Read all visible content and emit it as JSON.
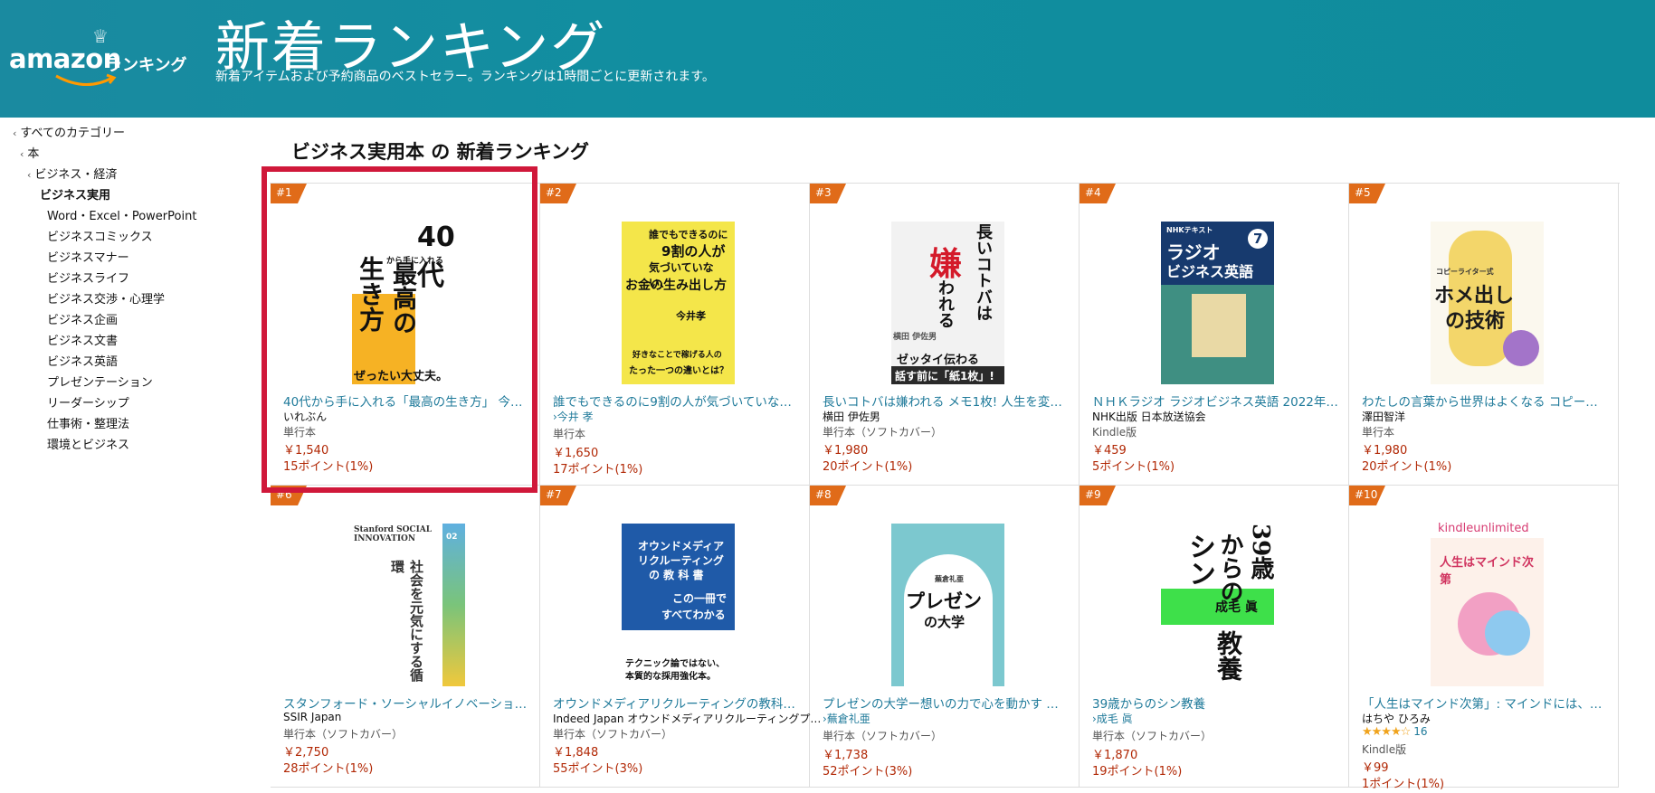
{
  "header": {
    "logo_word": "amazon",
    "logo_sub": "ランキング",
    "title": "新着ランキング",
    "subtitle": "新着アイテムおよび予約商品のベストセラー。ランキングは1時間ごとに更新されます。"
  },
  "sidebar": {
    "items": [
      {
        "label": "すべてのカテゴリー"
      },
      {
        "label": "本"
      },
      {
        "label": "ビジネス・経済"
      },
      {
        "label": "ビジネス実用"
      },
      {
        "label": "Word・Excel・PowerPoint"
      },
      {
        "label": "ビジネスコミックス"
      },
      {
        "label": "ビジネスマナー"
      },
      {
        "label": "ビジネスライフ"
      },
      {
        "label": "ビジネス交渉・心理学"
      },
      {
        "label": "ビジネス企画"
      },
      {
        "label": "ビジネス文書"
      },
      {
        "label": "ビジネス英語"
      },
      {
        "label": "プレゼンテーション"
      },
      {
        "label": "リーダーシップ"
      },
      {
        "label": "仕事術・整理法"
      },
      {
        "label": "環境とビジネス"
      }
    ]
  },
  "main": {
    "title": "ビジネス実用本 の 新着ランキング",
    "items": [
      {
        "rank": "#1",
        "title": "40代から手に入れる「最高の生き方」 今す…",
        "author": "いれぶん",
        "format": "単行本",
        "price": "￥1,540",
        "points": "15ポイント(1%)"
      },
      {
        "rank": "#2",
        "title": "誰でもできるのに9割の人が気づいていない…",
        "author": "›今井 孝",
        "format": "単行本",
        "price": "￥1,650",
        "points": "17ポイント(1%)"
      },
      {
        "rank": "#3",
        "title": "長いコトバは嫌われる メモ1枚! 人生を変え…",
        "author": "横田 伊佐男",
        "format": "単行本（ソフトカバー）",
        "price": "￥1,980",
        "points": "20ポイント(1%)"
      },
      {
        "rank": "#4",
        "title": "ＮＨＫラジオ ラジオビジネス英語 2022年 7…",
        "author": "NHK出版 日本放送協会",
        "format": "Kindle版",
        "price": "￥459",
        "points": "5ポイント(1%)"
      },
      {
        "rank": "#5",
        "title": "わたしの言葉から世界はよくなる コピーライ…",
        "author": "澤田智洋",
        "format": "単行本",
        "price": "￥1,980",
        "points": "20ポイント(1%)"
      },
      {
        "rank": "#6",
        "title": "スタンフォード・ソーシャルイノベーション…",
        "author": "SSIR Japan",
        "format": "単行本（ソフトカバー）",
        "price": "￥2,750",
        "points": "28ポイント(1%)"
      },
      {
        "rank": "#7",
        "title": "オウンドメディアリクルーティングの教科書…",
        "author": "Indeed Japan オウンドメディアリクルーティングプ…",
        "format": "単行本（ソフトカバー）",
        "price": "￥1,848",
        "points": "55ポイント(3%)"
      },
      {
        "rank": "#8",
        "title": "プレゼンの大学ー想いの力で心を動かす …",
        "author": "›蕪倉礼亜",
        "format": "単行本（ソフトカバー）",
        "price": "￥1,738",
        "points": "52ポイント(3%)"
      },
      {
        "rank": "#9",
        "title": "39歳からのシン教養",
        "author": "›成毛 眞",
        "format": "単行本（ソフトカバー）",
        "price": "￥1,870",
        "points": "19ポイント(1%)"
      },
      {
        "rank": "#10",
        "title": "「人生はマインド次第」: マインドには、か…",
        "author": "はちや ひろみ",
        "rating": 3.5,
        "reviews": "16",
        "format": "Kindle版",
        "price": "￥99",
        "points": "1ポイント(1%)"
      }
    ]
  },
  "covers": {
    "c1": {
      "a": "40代",
      "b": "最高の",
      "c": "生き方",
      "d": "から手に入れる",
      "e": "ぜったい大丈夫。"
    },
    "c2": {
      "a": "誰でもできるのに",
      "b": "9割の人が",
      "c": "気づいていない、",
      "d": "お金の生み出し方",
      "e": "今井孝",
      "f": "好きなことで稼げる人の",
      "g": "たった一つの違いとは？"
    },
    "c3": {
      "a": "長いコトバは",
      "b": "嫌",
      "c": "われる",
      "d": "ゼッタイ伝わる",
      "e": "話す前に「紙1枚」!",
      "f": "横田 伊佐男"
    },
    "c4": {
      "a": "ラジオ",
      "b": "ビジネス英語",
      "c": "7",
      "d": "NHKテキスト"
    },
    "c5": {
      "a": "ホメ出し",
      "b": "の技術",
      "c": "コピーライター式"
    },
    "c6": {
      "a": "Stanford SOCIAL",
      "b": "INNOVATION",
      "c": "社会を元気にする循環",
      "d": "02"
    },
    "c7": {
      "a": "オウンドメディア",
      "b": "リクルーティング",
      "c": "の 教 科 書",
      "d": "この一冊で",
      "e": "すべてわかる",
      "f": "テクニック論ではない、",
      "g": "本質的な採用強化本。"
    },
    "c8": {
      "a": "プレゼン",
      "b": "の大学",
      "c": "蕪倉礼亜"
    },
    "c9": {
      "a": "39歳",
      "b": "からの",
      "c": "シン",
      "d": "教養",
      "e": "成毛 眞"
    },
    "c10": {
      "a": "kindleunlimited",
      "b": "人生はマインド次第"
    }
  },
  "colors": {
    "header_bg": "#118ea0",
    "accent": "#e06b19",
    "link": "#1f7a9a",
    "price": "#b12704",
    "highlight": "#d0183a"
  }
}
